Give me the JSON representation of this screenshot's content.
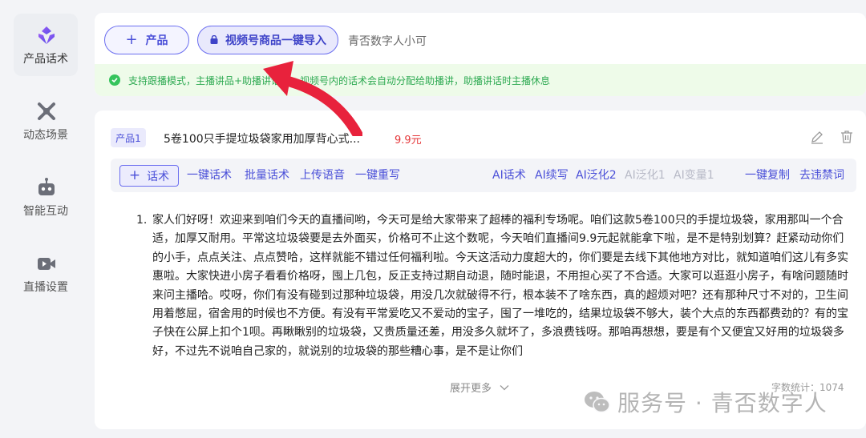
{
  "sidebar": {
    "items": [
      {
        "label": "产品话术",
        "icon": "diamond-logo-icon",
        "active": true
      },
      {
        "label": "动态场景",
        "icon": "scene-icon",
        "active": false
      },
      {
        "label": "智能互动",
        "icon": "robot-icon",
        "active": false
      },
      {
        "label": "直播设置",
        "icon": "video-camera-icon",
        "active": false
      }
    ]
  },
  "top_bar": {
    "add_product_label": "产品",
    "import_label": "视频号商品一键导入",
    "account_name": "青否数字人小可",
    "notice": "支持跟播模式，主播讲品+助播讲话术，视频号内的话术会自动分配给助播讲，助播讲话时主播休息"
  },
  "product": {
    "tag": "产品1",
    "title": "5卷100只手提垃圾袋家用加厚背心式...",
    "price": "9.9元",
    "toolbar": {
      "add_script": "话术",
      "left_links": [
        "一键话术",
        "批量话术",
        "上传语音",
        "一键重写"
      ],
      "ai_links": [
        "AI话术",
        "AI续写",
        "AI泛化2",
        "AI泛化1",
        "AI变量1"
      ],
      "ai_disabled": [
        false,
        false,
        false,
        true,
        true
      ],
      "right_links": [
        "一键复制",
        "去违禁词"
      ]
    },
    "script": {
      "number": "1.",
      "text": "家人们好呀！欢迎来到咱们今天的直播间哟，今天可是给大家带来了超棒的福利专场呢。咱们这款5卷100只的手提垃圾袋，家用那叫一个合适，加厚又耐用。平常这垃圾袋要是去外面买，价格可不止这个数呢，今天咱们直播间9.9元起就能拿下啦，是不是特别划算？赶紧动动你们的小手，点点关注、点点赞哈，这样就能不错过任何福利啦。今天这活动力度超大的，你们要是去线下其他地方对比，就知道咱们这儿有多实惠啦。大家快进小房子看看价格呀，囤上几包，反正支持过期自动退，随时能退，不用担心买了不合适。大家可以逛逛小房子，有啥问题随时来问主播哈。哎呀，你们有没有碰到过那种垃圾袋，用没几次就破得不行，根本装不了啥东西，真的超烦对吧？还有那种尺寸不对的，卫生间用着憋屈，宿舍用的时候也不方便。有没有平常爱吃又不爱动的宝子，囤了一堆吃的，结果垃圾袋不够大，装个大点的东西都费劲的？有的宝子快在公屏上扣个1呗。再瞅瞅别的垃圾袋，又贵质量还差，用没多久就坏了，多浪费钱呀。那咱再想想，要是有个又便宜又好用的垃圾袋多好，不过先不说咱自己家的，就说别的垃圾袋的那些糟心事，是不是让你们"
    },
    "expand_label": "展开更多",
    "word_count": "字数统计：1074"
  },
  "watermark": "服务号 · 青否数字人",
  "colors": {
    "accent": "#4a4fd8",
    "notice_green": "#2eaa52",
    "price_red": "#e5383b",
    "arrow_red": "#e8223c"
  }
}
